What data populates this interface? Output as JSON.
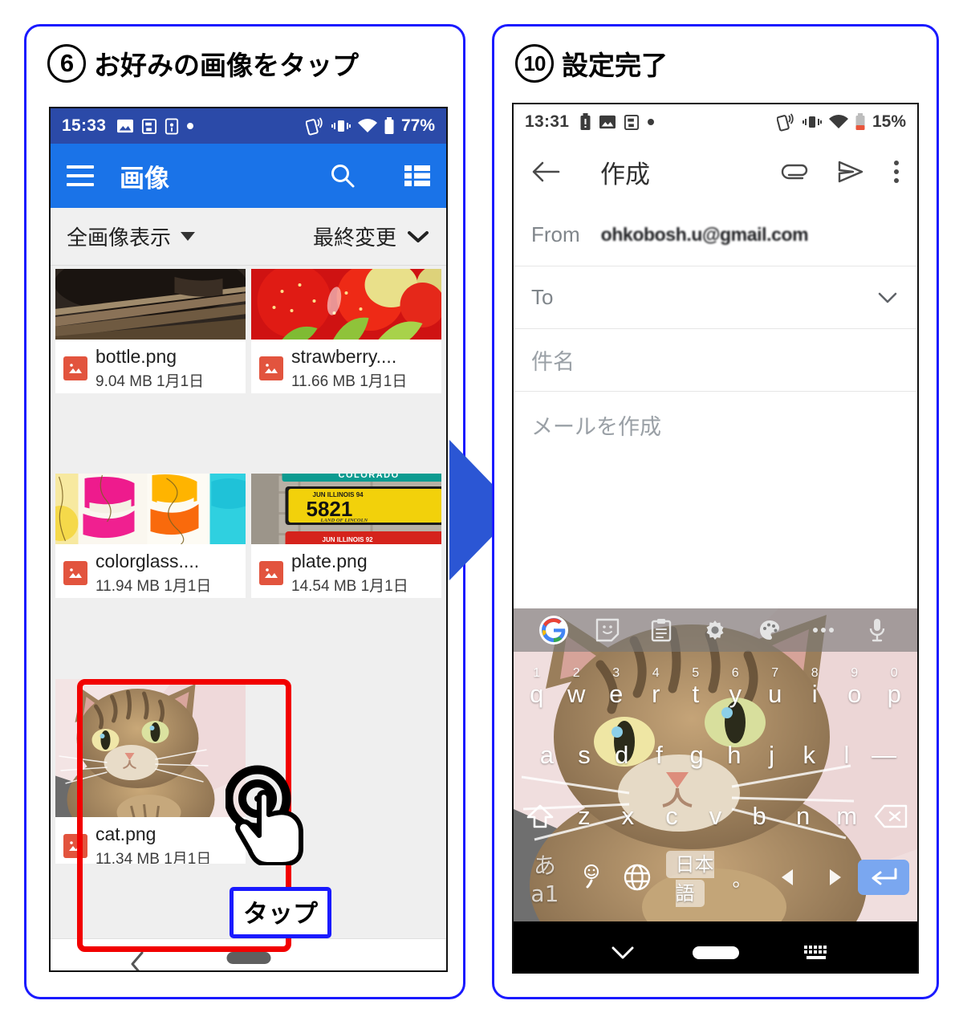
{
  "steps": [
    {
      "number": "6",
      "title": "お好みの画像をタップ"
    },
    {
      "number": "10",
      "title": "設定完了"
    }
  ],
  "left_phone": {
    "status_bar": {
      "time": "15:33",
      "battery_percent": "77%",
      "icons_left": [
        "image-icon",
        "clipboard-icon",
        "sd-card-icon",
        "dot-icon"
      ],
      "icons_right": [
        "nfc-icon",
        "vibrate-icon",
        "wifi-icon",
        "battery-icon"
      ]
    },
    "app_bar": {
      "menu_icon": "hamburger-icon",
      "title": "画像",
      "search_icon": "search-icon",
      "view_icon": "list-view-icon"
    },
    "filter_bar": {
      "left_label": "全画像表示",
      "left_caret": "caret-down-icon",
      "right_label": "最終変更",
      "right_caret": "chevron-down-icon"
    },
    "files": [
      {
        "name": "bottle.png",
        "size": "9.04 MB",
        "date": "1月1日",
        "thumb": "basket-photo"
      },
      {
        "name": "strawberry....",
        "size": "11.66 MB",
        "date": "1月1日",
        "thumb": "strawberry-photo"
      },
      {
        "name": "colorglass....",
        "size": "11.94 MB",
        "date": "1月1日",
        "thumb": "colorglass-photo"
      },
      {
        "name": "plate.png",
        "size": "14.54 MB",
        "date": "1月1日",
        "thumb": "license-plate-photo"
      },
      {
        "name": "cat.png",
        "size": "11.34 MB",
        "date": "1月1日",
        "thumb": "cat-photo",
        "highlighted": true
      }
    ],
    "nav_bar": {
      "back_icon": "chevron-left-icon",
      "home_pill": "home-pill"
    },
    "callout": {
      "label": "タップ",
      "gesture_icon": "tap-gesture-icon"
    }
  },
  "right_phone": {
    "status_bar": {
      "time": "13:31",
      "battery_percent": "15%",
      "icons_left": [
        "battery-alert-icon",
        "image-icon",
        "clipboard-icon",
        "dot-icon"
      ],
      "icons_right": [
        "nfc-icon",
        "vibrate-icon",
        "wifi-icon",
        "battery-low-icon"
      ]
    },
    "compose_bar": {
      "back_icon": "back-arrow-icon",
      "title": "作成",
      "attach_icon": "paperclip-icon",
      "send_icon": "send-icon",
      "more_icon": "overflow-menu-icon"
    },
    "fields": {
      "from_label": "From",
      "from_value": "ohkobosh.u@gmail.com",
      "to_label": "To",
      "to_expand_icon": "chevron-down-icon",
      "subject_placeholder": "件名",
      "body_placeholder": "メールを作成"
    },
    "keyboard": {
      "toolbar_icons": [
        "google-g-icon",
        "sticker-icon",
        "clipboard-icon",
        "gear-icon",
        "palette-icon",
        "more-dots-icon",
        "microphone-icon"
      ],
      "row1": [
        {
          "key": "q",
          "num": "1"
        },
        {
          "key": "w",
          "num": "2"
        },
        {
          "key": "e",
          "num": "3"
        },
        {
          "key": "r",
          "num": "4"
        },
        {
          "key": "t",
          "num": "5"
        },
        {
          "key": "y",
          "num": "6"
        },
        {
          "key": "u",
          "num": "7"
        },
        {
          "key": "i",
          "num": "8"
        },
        {
          "key": "o",
          "num": "9"
        },
        {
          "key": "p",
          "num": "0"
        }
      ],
      "row2": [
        "a",
        "s",
        "d",
        "f",
        "g",
        "h",
        "j",
        "k",
        "l",
        "—"
      ],
      "row3": {
        "shift": "shift-icon",
        "keys": [
          "z",
          "x",
          "c",
          "v",
          "b",
          "n",
          "m"
        ],
        "backspace": "backspace-icon"
      },
      "row4": {
        "mode": "あa1",
        "emoji_icon": "emoji-icon",
        "comma": "、",
        "globe_icon": "globe-icon",
        "lang_chip": "日本語",
        "period": "。",
        "left_icon": "arrow-left-icon",
        "right_icon": "arrow-right-icon",
        "enter_icon": "enter-icon"
      }
    },
    "nav_bar": {
      "down_icon": "chevron-down-icon",
      "home_pill": "home-pill",
      "keyboard_icon": "keyboard-icon"
    }
  },
  "flow_arrow": {
    "icon": "right-arrow-icon",
    "color": "#2b56d4"
  },
  "colors": {
    "frame_blue": "#1a1aff",
    "status_bar_blue": "#2b4aa8",
    "app_bar_blue": "#1a73e8",
    "highlight_red": "#f20000",
    "badge_red": "#e2543e",
    "enter_key_blue": "#7aa7f0"
  }
}
